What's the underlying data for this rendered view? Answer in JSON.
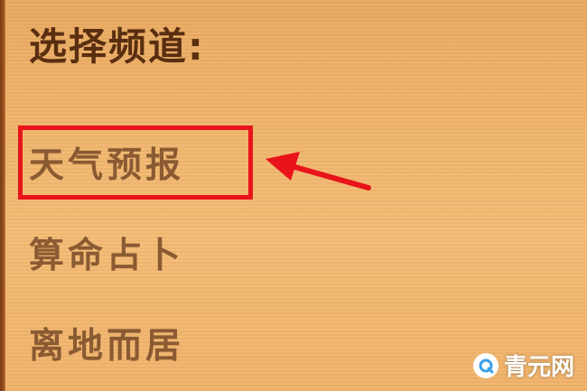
{
  "panel": {
    "heading": "选择频道:",
    "channels": [
      {
        "label": "天气预报",
        "highlighted": true
      },
      {
        "label": "算命占卜",
        "highlighted": false
      },
      {
        "label": "离地而居",
        "highlighted": false
      }
    ]
  },
  "annotation": {
    "color": "#e8141a",
    "arrow_icon": "arrow-left-icon"
  },
  "watermark": {
    "text": "青元网",
    "icon": "q-logo-icon"
  },
  "colors": {
    "background": "#f0b56d",
    "heading": "#5a2e10",
    "channel_text": "#8a5a32",
    "border": "#7a3c12"
  }
}
